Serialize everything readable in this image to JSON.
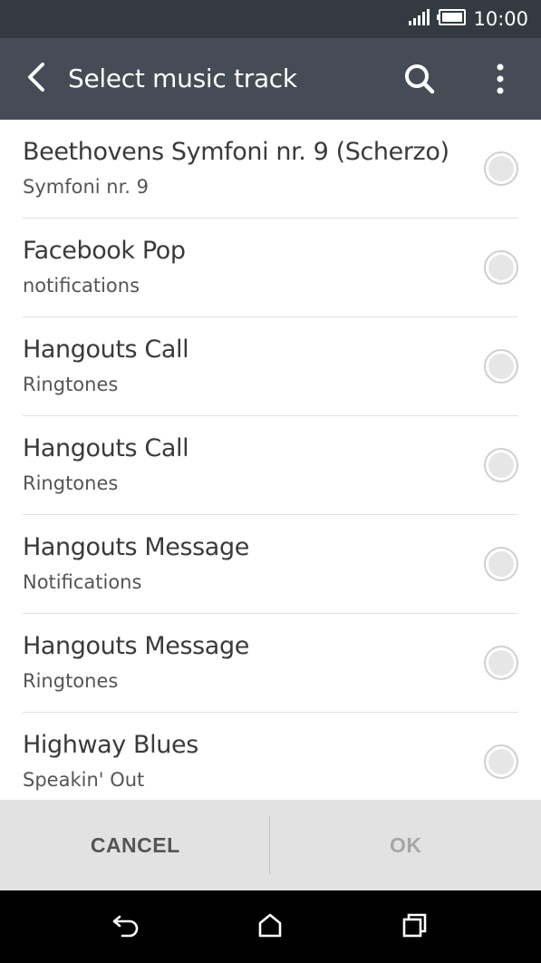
{
  "status_bar": {
    "time": "10:00"
  },
  "app_bar": {
    "title": "Select music track"
  },
  "tracks": [
    {
      "title": "Beethovens Symfoni nr. 9 (Scherzo)",
      "subtitle": "Symfoni nr. 9"
    },
    {
      "title": "Facebook Pop",
      "subtitle": "notifications"
    },
    {
      "title": "Hangouts Call",
      "subtitle": "Ringtones"
    },
    {
      "title": "Hangouts Call",
      "subtitle": "Ringtones"
    },
    {
      "title": "Hangouts Message",
      "subtitle": "Notifications"
    },
    {
      "title": "Hangouts Message",
      "subtitle": "Ringtones"
    },
    {
      "title": "Highway Blues",
      "subtitle": "Speakin' Out"
    }
  ],
  "buttons": {
    "cancel": "CANCEL",
    "ok": "OK"
  },
  "icons": {
    "status": [
      "signal-icon",
      "battery-icon"
    ],
    "app_bar": [
      "back-arrow-icon",
      "search-icon",
      "more-vert-icon"
    ],
    "nav": [
      "back-icon",
      "home-icon",
      "recents-icon"
    ]
  },
  "colors": {
    "status_bar": "#343a42",
    "app_bar": "#464c55",
    "button_bar": "#e2e2e2",
    "nav_bar": "#000000"
  }
}
